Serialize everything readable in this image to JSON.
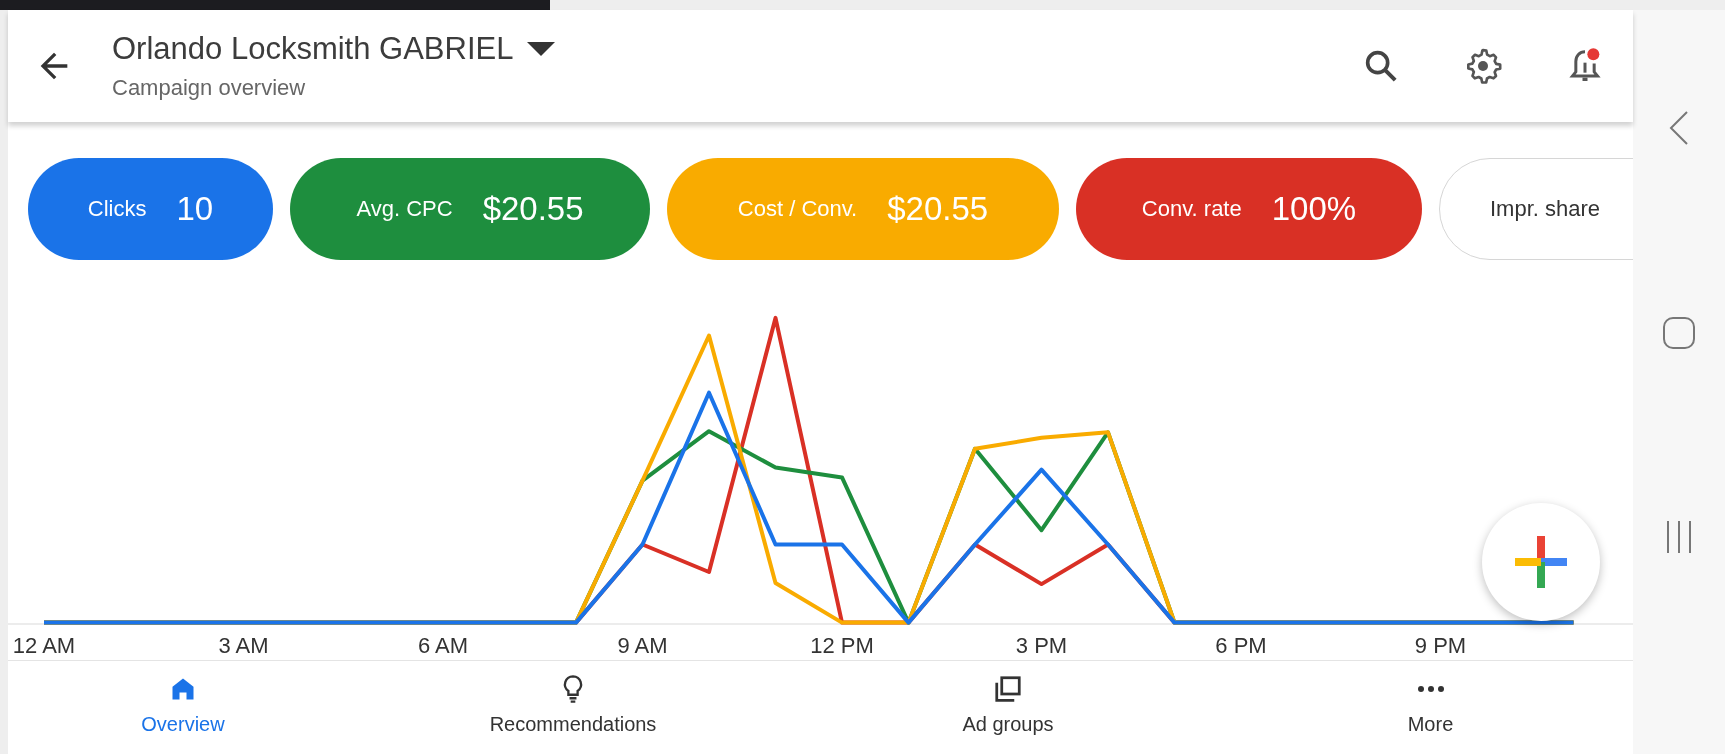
{
  "top_bar": {
    "title": "Orlando Locksmith GABRIEL",
    "subtitle": "Campaign overview",
    "notification_unread": true
  },
  "metrics": [
    {
      "label": "Clicks",
      "value": "10",
      "selected": true,
      "color": "#1a73e8"
    },
    {
      "label": "Avg. CPC",
      "value": "$20.55",
      "selected": true,
      "color": "#1e8e3e"
    },
    {
      "label": "Cost / Conv.",
      "value": "$20.55",
      "selected": true,
      "color": "#f9ab00"
    },
    {
      "label": "Conv. rate",
      "value": "100%",
      "selected": true,
      "color": "#d93025"
    },
    {
      "label": "Impr. share",
      "selected": false
    }
  ],
  "chart": {
    "x_labels": [
      "12 AM",
      "3 AM",
      "6 AM",
      "9 AM",
      "12 PM",
      "3 PM",
      "6 PM",
      "9 PM"
    ]
  },
  "bottom_nav": [
    {
      "label": "Overview",
      "kind": "home",
      "selected": true
    },
    {
      "label": "Recommendations",
      "kind": "bulb",
      "selected": false
    },
    {
      "label": "Ad groups",
      "kind": "layers",
      "selected": false
    },
    {
      "label": "More",
      "kind": "more",
      "selected": false
    }
  ]
}
